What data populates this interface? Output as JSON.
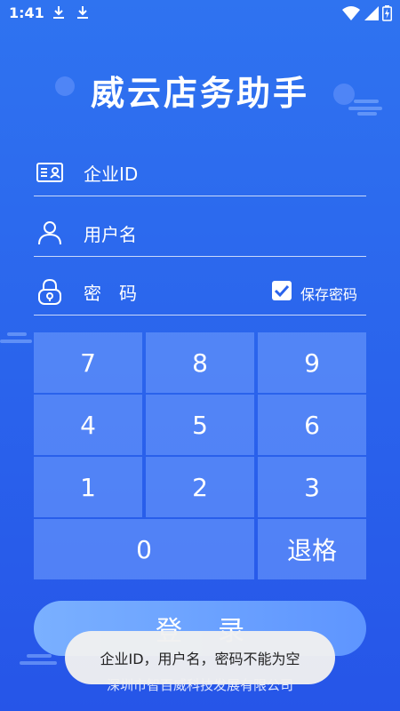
{
  "status_bar": {
    "time": "1:41",
    "icons": [
      "download-icon",
      "download-icon",
      "wifi-icon",
      "signal-icon",
      "battery-charging-icon"
    ]
  },
  "app": {
    "title": "威云店务助手"
  },
  "form": {
    "company_id": {
      "placeholder": "企业ID",
      "icon": "id-card-icon"
    },
    "username": {
      "placeholder": "用户名",
      "icon": "user-icon"
    },
    "password": {
      "placeholder": "密　码",
      "icon": "lock-icon"
    },
    "remember_password": {
      "label": "保存密码",
      "checked": true
    }
  },
  "keypad": {
    "keys": [
      "7",
      "8",
      "9",
      "4",
      "5",
      "6",
      "1",
      "2",
      "3",
      "0"
    ],
    "backspace_label": "退格"
  },
  "login": {
    "label": "登录"
  },
  "footer": {
    "company": "深圳市智百威科技发展有限公司"
  },
  "toast": {
    "message": "企业ID，用户名，密码不能为空"
  },
  "colors": {
    "background": "#2a63ec",
    "key": "#6f9cff",
    "button": "#6ea4ff",
    "toast": "#f0f0f0"
  }
}
